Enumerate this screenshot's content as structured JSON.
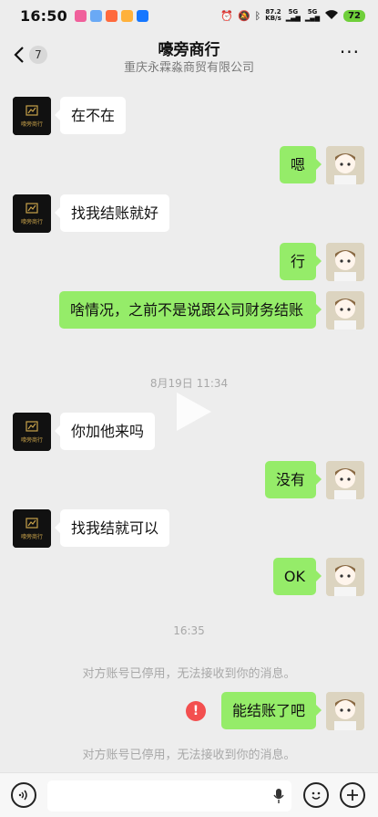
{
  "status_bar": {
    "time": "16:50",
    "net_speed_value": "87.2",
    "net_speed_unit": "KB/s",
    "sig1": "5G",
    "sig2": "5G",
    "battery": "72"
  },
  "header": {
    "back_badge": "7",
    "title": "嚎旁商行",
    "subtitle": "重庆永霖淼商贸有限公司",
    "more": "···"
  },
  "brand": {
    "logo_text": "嚎旁商行"
  },
  "messages": [
    {
      "side": "left",
      "text": "在不在"
    },
    {
      "side": "right",
      "text": "嗯"
    },
    {
      "side": "left",
      "text": "找我结账就好"
    },
    {
      "side": "right",
      "text": "行"
    },
    {
      "side": "right",
      "text": "啥情况，之前不是说跟公司财务结账"
    },
    {
      "side": "left",
      "text": "你加他来吗"
    },
    {
      "side": "right",
      "text": "没有"
    },
    {
      "side": "left",
      "text": "找我结就可以"
    },
    {
      "side": "right",
      "text": "OK"
    },
    {
      "side": "right",
      "text": "能结账了吧"
    }
  ],
  "timestamps": {
    "t1": "8月19日 11:34",
    "t2": "16:35"
  },
  "system": {
    "notice1": "对方账号已停用，无法接收到你的消息。",
    "notice2": "对方账号已停用，无法接收到你的消息。",
    "error_mark": "!"
  },
  "colors": {
    "sent_bubble": "#95ec69",
    "received_bubble": "#ffffff",
    "background": "#ededed",
    "error": "#f34f4f"
  }
}
